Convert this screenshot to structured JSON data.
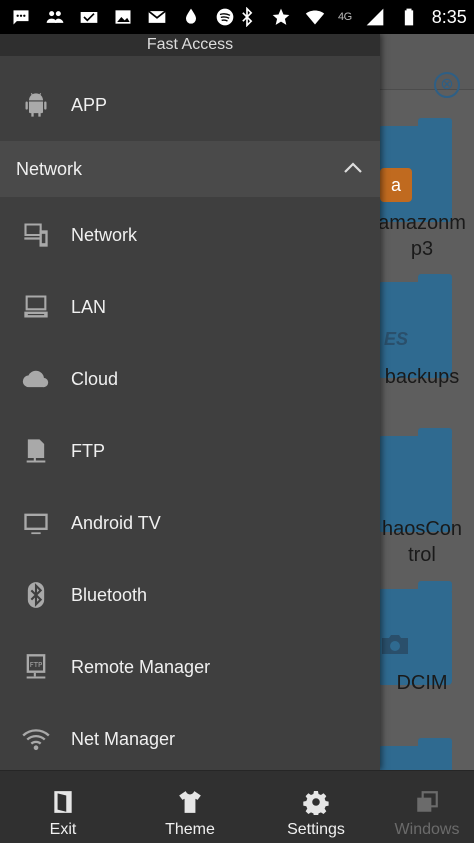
{
  "status_bar": {
    "network_type": "4G",
    "time": "8:35"
  },
  "drawer": {
    "title": "Fast Access",
    "app_item": {
      "label": "APP",
      "icon": "android-icon"
    },
    "section": {
      "label": "Network",
      "expanded": true
    },
    "items": [
      {
        "label": "Network",
        "icon": "network-devices-icon"
      },
      {
        "label": "LAN",
        "icon": "lan-computer-icon"
      },
      {
        "label": "Cloud",
        "icon": "cloud-icon"
      },
      {
        "label": "FTP",
        "icon": "ftp-server-icon"
      },
      {
        "label": "Android TV",
        "icon": "tv-icon"
      },
      {
        "label": "Bluetooth",
        "icon": "bluetooth-icon"
      },
      {
        "label": "Remote Manager",
        "icon": "remote-manager-icon"
      },
      {
        "label": "Net Manager",
        "icon": "wifi-manager-icon"
      }
    ]
  },
  "background": {
    "folders": [
      {
        "label_line1": "amazonm",
        "label_line2": "p3",
        "badge": "a"
      },
      {
        "label_line1": "backups",
        "label_line2": "",
        "badge": "ES"
      },
      {
        "label_line1": "haosCon",
        "label_line2": "trol",
        "badge": ""
      },
      {
        "label_line1": "DCIM",
        "label_line2": "",
        "badge": "camera"
      }
    ]
  },
  "bottom_bar": {
    "items": [
      {
        "label": "Exit",
        "icon": "exit-door-icon"
      },
      {
        "label": "Theme",
        "icon": "tshirt-icon"
      },
      {
        "label": "Settings",
        "icon": "gear-icon"
      },
      {
        "label": "Windows",
        "icon": "windows-stack-icon"
      }
    ]
  },
  "colors": {
    "drawer_bg": "#3f3f3f",
    "section_bg": "#4a4a4a",
    "icon_gray": "#a9a9a9",
    "folder_blue": "#2f6a90",
    "accent_blue": "#2e5f85"
  }
}
